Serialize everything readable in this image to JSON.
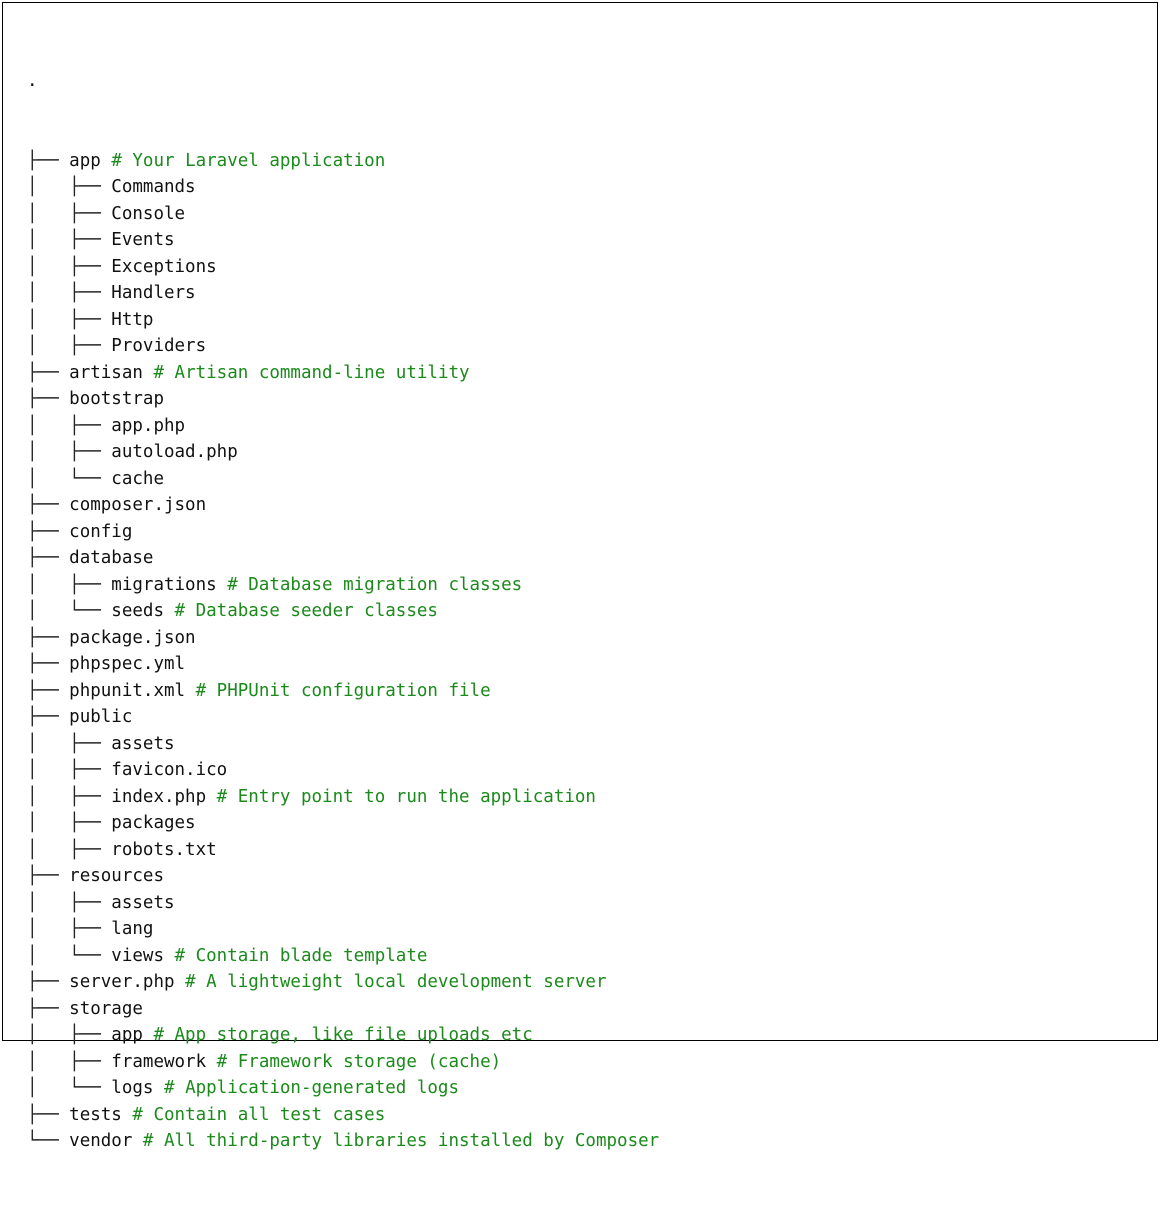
{
  "root": ".",
  "colors": {
    "comment": "#1a8a1a",
    "text": "#111111",
    "border": "#000000"
  },
  "tree": [
    {
      "prefix": "├── ",
      "name": "app",
      "comment": "# Your Laravel application"
    },
    {
      "prefix": "│   ├── ",
      "name": "Commands",
      "comment": ""
    },
    {
      "prefix": "│   ├── ",
      "name": "Console",
      "comment": ""
    },
    {
      "prefix": "│   ├── ",
      "name": "Events",
      "comment": ""
    },
    {
      "prefix": "│   ├── ",
      "name": "Exceptions",
      "comment": ""
    },
    {
      "prefix": "│   ├── ",
      "name": "Handlers",
      "comment": ""
    },
    {
      "prefix": "│   ├── ",
      "name": "Http",
      "comment": ""
    },
    {
      "prefix": "│   ├── ",
      "name": "Providers",
      "comment": ""
    },
    {
      "prefix": "├── ",
      "name": "artisan",
      "comment": "# Artisan command-line utility"
    },
    {
      "prefix": "├── ",
      "name": "bootstrap",
      "comment": ""
    },
    {
      "prefix": "│   ├── ",
      "name": "app.php",
      "comment": ""
    },
    {
      "prefix": "│   ├── ",
      "name": "autoload.php",
      "comment": ""
    },
    {
      "prefix": "│   └── ",
      "name": "cache",
      "comment": ""
    },
    {
      "prefix": "├── ",
      "name": "composer.json",
      "comment": ""
    },
    {
      "prefix": "├── ",
      "name": "config",
      "comment": ""
    },
    {
      "prefix": "├── ",
      "name": "database",
      "comment": ""
    },
    {
      "prefix": "│   ├── ",
      "name": "migrations",
      "comment": "# Database migration classes"
    },
    {
      "prefix": "│   └── ",
      "name": "seeds",
      "comment": "# Database seeder classes"
    },
    {
      "prefix": "├── ",
      "name": "package.json",
      "comment": ""
    },
    {
      "prefix": "├── ",
      "name": "phpspec.yml",
      "comment": ""
    },
    {
      "prefix": "├── ",
      "name": "phpunit.xml",
      "comment": "# PHPUnit configuration file"
    },
    {
      "prefix": "├── ",
      "name": "public",
      "comment": ""
    },
    {
      "prefix": "│   ├── ",
      "name": "assets",
      "comment": ""
    },
    {
      "prefix": "│   ├── ",
      "name": "favicon.ico",
      "comment": ""
    },
    {
      "prefix": "│   ├── ",
      "name": "index.php",
      "comment": "# Entry point to run the application"
    },
    {
      "prefix": "│   ├── ",
      "name": "packages",
      "comment": ""
    },
    {
      "prefix": "│   ├── ",
      "name": "robots.txt",
      "comment": ""
    },
    {
      "prefix": "├── ",
      "name": "resources",
      "comment": ""
    },
    {
      "prefix": "│   ├── ",
      "name": "assets",
      "comment": ""
    },
    {
      "prefix": "│   ├── ",
      "name": "lang",
      "comment": ""
    },
    {
      "prefix": "│   └── ",
      "name": "views",
      "comment": "# Contain blade template"
    },
    {
      "prefix": "├── ",
      "name": "server.php",
      "comment": "# A lightweight local development server"
    },
    {
      "prefix": "├── ",
      "name": "storage",
      "comment": ""
    },
    {
      "prefix": "│   ├── ",
      "name": "app",
      "comment": "# App storage, like file uploads etc"
    },
    {
      "prefix": "│   ├── ",
      "name": "framework",
      "comment": "# Framework storage (cache)"
    },
    {
      "prefix": "│   └── ",
      "name": "logs",
      "comment": "# Application-generated logs"
    },
    {
      "prefix": "├── ",
      "name": "tests",
      "comment": "# Contain all test cases"
    },
    {
      "prefix": "└── ",
      "name": "vendor",
      "comment": "# All third-party libraries installed by Composer"
    }
  ]
}
